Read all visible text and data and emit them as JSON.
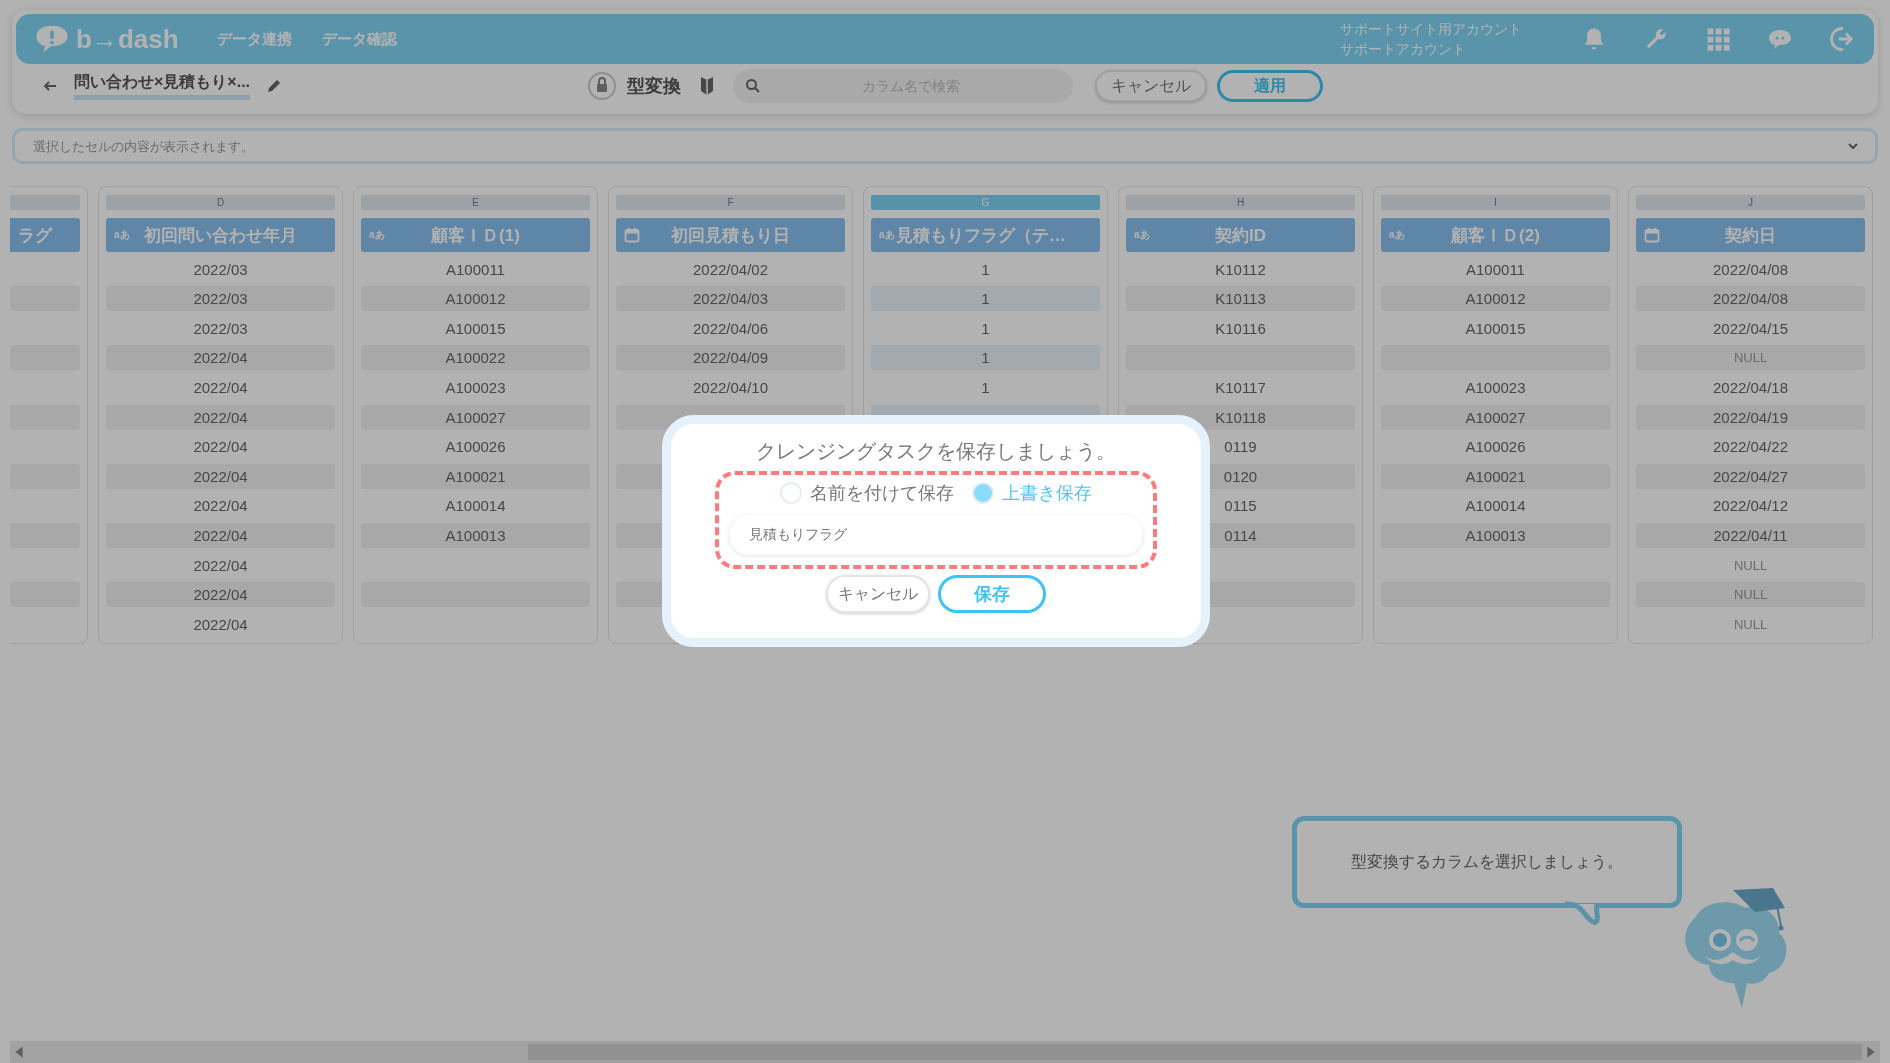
{
  "app_bar": {
    "logo": "b→dash",
    "nav": [
      "データ連携",
      "データ確認"
    ],
    "account_lines": [
      "サポートサイト用アカウント",
      "サポートアカウント"
    ]
  },
  "toolbar": {
    "task_title": "問い合わせ×見積もり×...",
    "mode_title": "型変換",
    "search": {
      "placeholder": "カラム名で検索"
    },
    "buttons": [
      {
        "label": "キャンセル",
        "kind": "secondary"
      },
      {
        "label": "適用",
        "kind": "primary"
      }
    ]
  },
  "cell_preview": {
    "placeholder": "選択したセルの内容が表示されます。"
  },
  "columns": [
    {
      "kind": "clipped",
      "selected": false,
      "header": "ラグ",
      "cells": [
        null,
        null,
        null,
        null,
        null,
        null,
        null,
        null,
        null,
        null,
        null,
        null,
        null
      ]
    },
    {
      "kind": "text",
      "letter": "D",
      "type_icon_text": "aあ",
      "header": "初回問い合わせ年月",
      "selected": false,
      "cells": [
        "2022/03",
        "2022/03",
        "2022/03",
        "2022/04",
        "2022/04",
        "2022/04",
        "2022/04",
        "2022/04",
        "2022/04",
        "2022/04",
        "2022/04",
        "2022/04",
        "2022/04"
      ]
    },
    {
      "kind": "text",
      "letter": "E",
      "type_icon_text": "aあ",
      "header": "顧客ＩＤ(1)",
      "selected": false,
      "cells": [
        "A100011",
        "A100012",
        "A100015",
        "A100022",
        "A100023",
        "A100027",
        "A100026",
        "A100021",
        "A100014",
        "A100013",
        null,
        null,
        null
      ]
    },
    {
      "kind": "date",
      "letter": "F",
      "header": "初回見積もり日",
      "selected": false,
      "cells": [
        "2022/04/02",
        "2022/04/03",
        "2022/04/06",
        "2022/04/09",
        "2022/04/10",
        null,
        null,
        null,
        null,
        null,
        null,
        null,
        null
      ]
    },
    {
      "kind": "text",
      "letter": "G",
      "type_icon_text": "aあ",
      "header": "見積もりフラグ（テ…",
      "selected": true,
      "cells": [
        "1",
        "1",
        "1",
        "1",
        "1",
        null,
        null,
        null,
        null,
        null,
        null,
        null,
        null
      ]
    },
    {
      "kind": "text",
      "letter": "H",
      "type_icon_text": "aあ",
      "header": "契約ID",
      "selected": false,
      "cells": [
        "K10112",
        "K10113",
        "K10116",
        null,
        "K10117",
        "K10118",
        "0119",
        "0120",
        "0115",
        "0114",
        null,
        null,
        null
      ]
    },
    {
      "kind": "text",
      "letter": "I",
      "type_icon_text": "aあ",
      "header": "顧客ＩＤ(2)",
      "selected": false,
      "cells": [
        "A100011",
        "A100012",
        "A100015",
        null,
        "A100023",
        "A100027",
        "A100026",
        "A100021",
        "A100014",
        "A100013",
        null,
        null,
        null
      ]
    },
    {
      "kind": "date",
      "letter": "J",
      "header": "契約日",
      "selected": false,
      "cells": [
        "2022/04/08",
        "2022/04/08",
        "2022/04/15",
        {
          "text": "NULL",
          "kind": "null_value"
        },
        "2022/04/18",
        "2022/04/19",
        "2022/04/22",
        "2022/04/27",
        "2022/04/12",
        "2022/04/11",
        {
          "text": "NULL",
          "kind": "null_value"
        },
        {
          "text": "NULL",
          "kind": "null_value"
        },
        {
          "text": "NULL",
          "kind": "null_value"
        }
      ]
    }
  ],
  "guide_bubble": {
    "text": "型変換するカラムを選択しましょう。"
  },
  "dialog": {
    "title": "クレンジングタスクを保存しましょう。",
    "highlighted": true,
    "options": [
      {
        "label": "名前を付けて保存",
        "selected": false
      },
      {
        "label": "上書き保存",
        "selected": true
      }
    ],
    "name_field": {
      "value": "見積もりフラグ"
    },
    "buttons": [
      {
        "label": "キャンセル",
        "kind": "secondary"
      },
      {
        "label": "保存",
        "kind": "primary"
      }
    ]
  }
}
